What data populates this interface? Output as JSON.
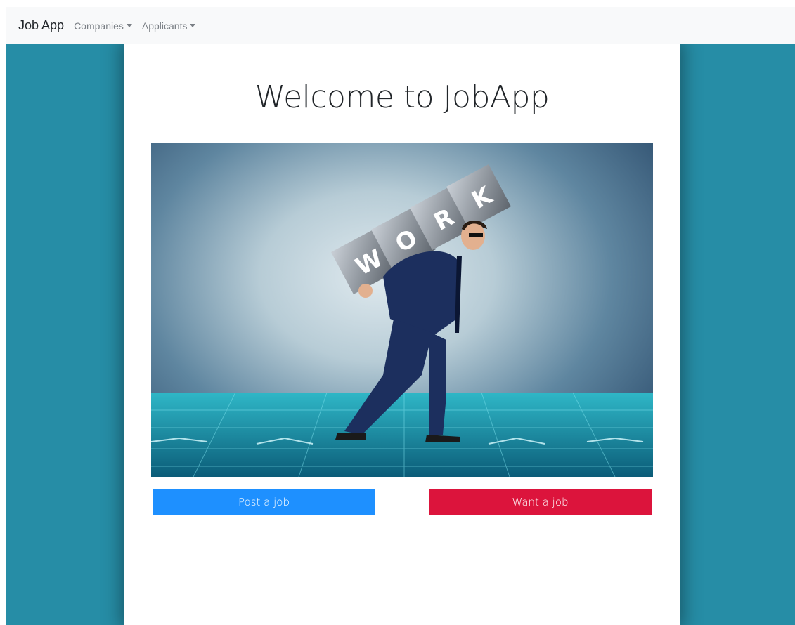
{
  "navbar": {
    "brand": "Job App",
    "menus": [
      {
        "label": "Companies"
      },
      {
        "label": "Applicants"
      }
    ]
  },
  "main": {
    "title": "Welcome to JobApp",
    "hero_text": "WORK",
    "buttons": {
      "post_label": "Post a job",
      "want_label": "Want a job"
    }
  },
  "colors": {
    "background": "#268da6",
    "navbar": "#f8f9fa",
    "post_button": "#1e90ff",
    "want_button": "#dc143c"
  },
  "icons": {
    "dropdown": "caret-down-icon"
  }
}
